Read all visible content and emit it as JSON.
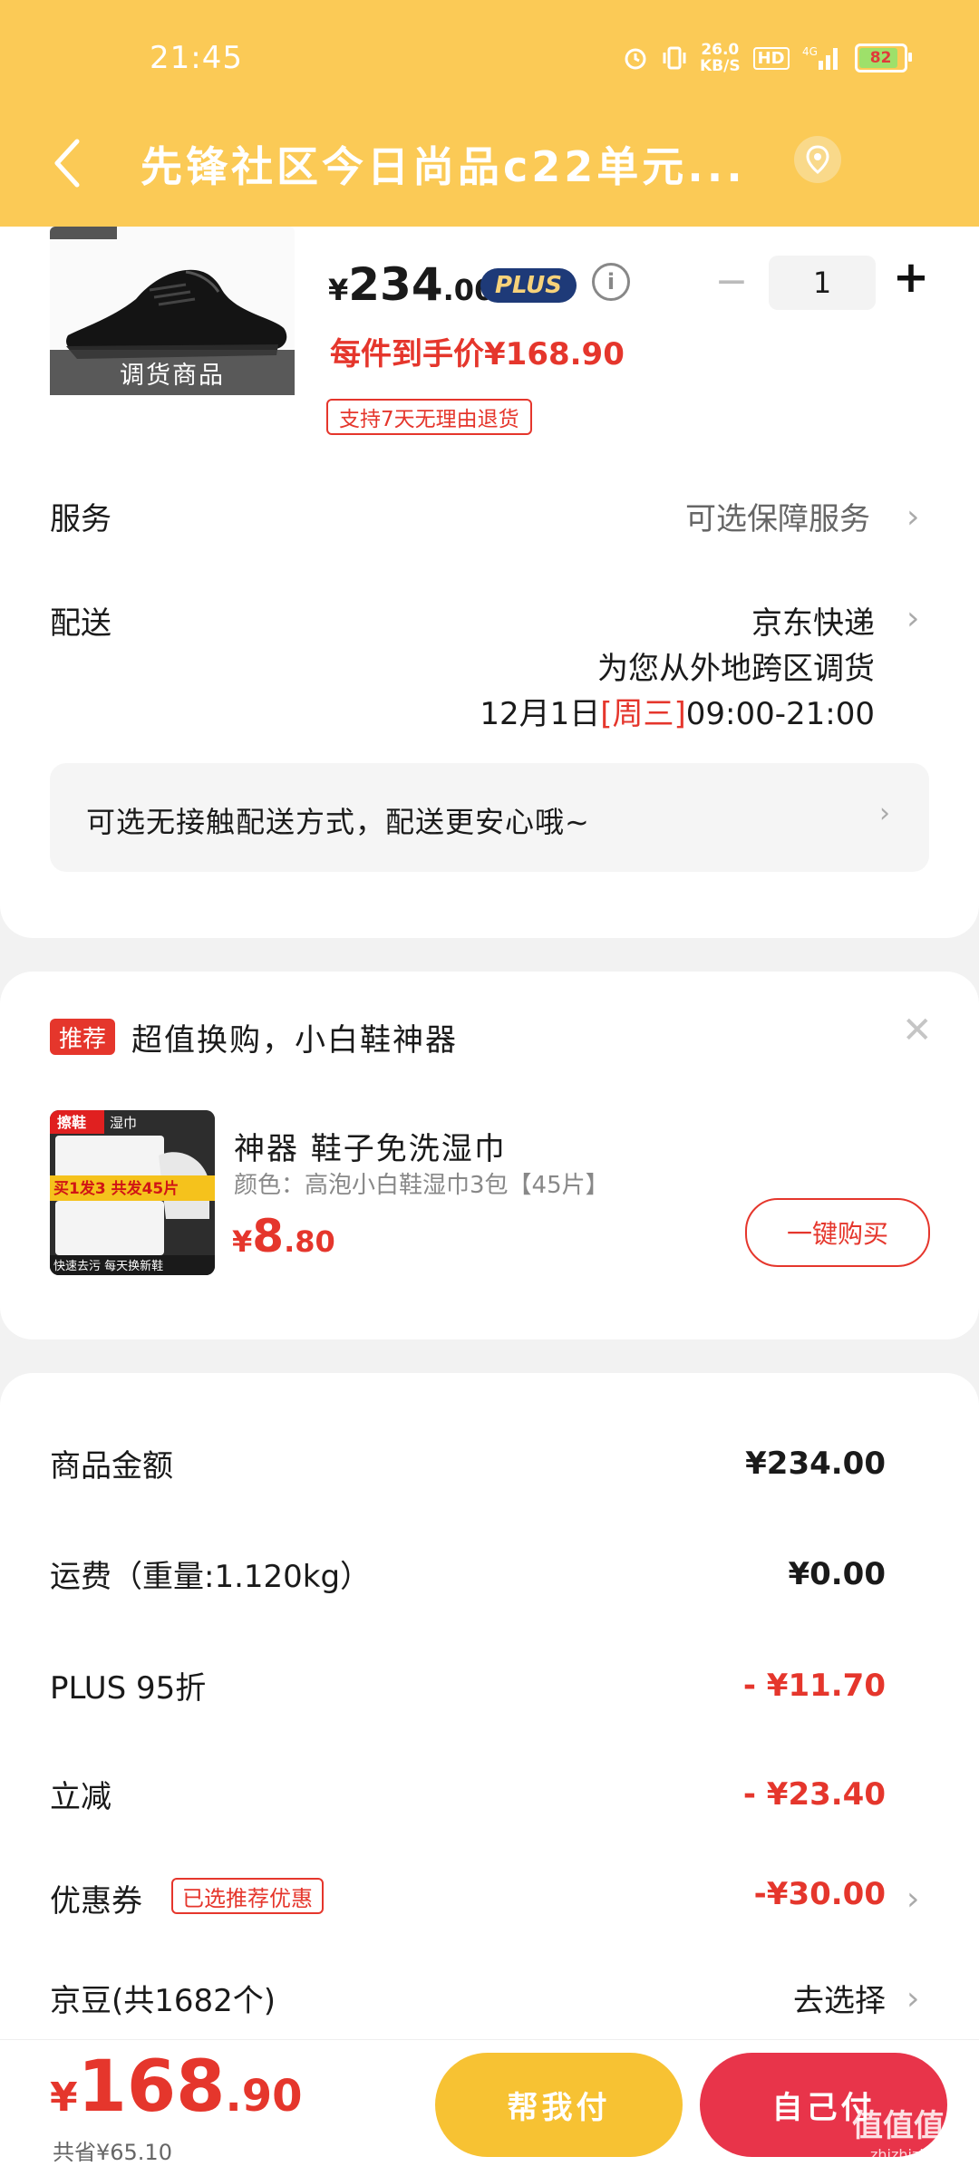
{
  "status_bar": {
    "time": "21:45",
    "net_speed": "26.0",
    "net_unit": "KB/S",
    "hd": "HD",
    "signal": "4G",
    "battery": "82"
  },
  "header": {
    "title": "先锋社区今日尚品c22单元...",
    "back_icon": "chevron-left-icon",
    "location_icon": "location-pin-icon"
  },
  "product": {
    "image_tag": "调货商品",
    "price_yen": "¥",
    "price_int": "234",
    "price_dec": ".00",
    "plus_badge": "PLUS",
    "quantity": "1",
    "qty_minus": "−",
    "qty_plus": "+",
    "final_price": "每件到手价¥168.90",
    "return_policy": "支持7天无理由退货"
  },
  "service": {
    "label": "服务",
    "value": "可选保障服务"
  },
  "delivery": {
    "label": "配送",
    "carrier": "京东快递",
    "note": "为您从外地跨区调货",
    "date": "12月1日",
    "weekday": "[周三]",
    "time_window": "09:00-21:00",
    "contactless": "可选无接触配送方式，配送更安心哦~"
  },
  "recommend": {
    "badge": "推荐",
    "title": "超值换购，小白鞋神器",
    "item_name": "神器 鞋子免洗湿巾",
    "item_spec": "颜色：高泡小白鞋湿巾3包【45片】",
    "price_yen": "¥",
    "price_int": "8",
    "price_dec": ".80",
    "buy_button": "一键购买",
    "img_label_top": "擦鞋",
    "img_label_top2": "湿巾",
    "img_label_mid": "买1发3 共发45片",
    "img_label_bottom": "快速去污 每天换新鞋"
  },
  "summary": {
    "items": [
      {
        "label": "商品金额",
        "value": "¥234.00"
      },
      {
        "label": "运费（重量:1.120kg）",
        "value": "¥0.00"
      },
      {
        "label": "PLUS 95折",
        "value": "- ¥11.70"
      },
      {
        "label": "立减",
        "value": "- ¥23.40"
      },
      {
        "label": "优惠券",
        "value": "-¥30.00",
        "tag": "已选推荐优惠"
      },
      {
        "label": "京豆(共1682个)",
        "value": "去选择"
      }
    ]
  },
  "bottom": {
    "total_yen": "¥",
    "total_int": "168",
    "total_dec": ".90",
    "saved": "共省¥65.10",
    "help_pay": "帮我付",
    "self_pay": "自己付",
    "watermark": "值值值",
    "watermark_sub": "zhizhizhi.com"
  },
  "colors": {
    "header": "#fbca56",
    "accent_red": "#e5362c",
    "help_pay": "#f7c233",
    "self_pay": "#e8344a"
  }
}
